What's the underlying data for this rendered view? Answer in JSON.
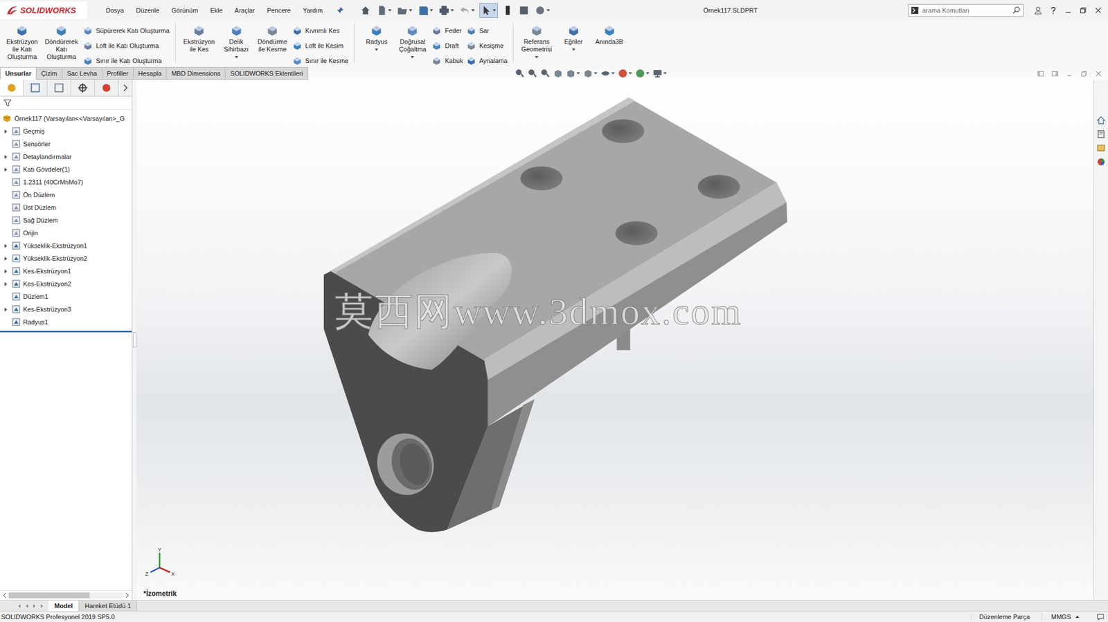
{
  "app": {
    "logo": "SOLIDWORKS",
    "title": "Örnek117.SLDPRT"
  },
  "menu": [
    "Dosya",
    "Düzenle",
    "Görünüm",
    "Ekle",
    "Araçlar",
    "Pencere",
    "Yardım"
  ],
  "search": {
    "placeholder": "arama Komutları"
  },
  "command_groups": [
    {
      "kind": "large",
      "lines": [
        "Ekstrüzyon",
        "ile Katı",
        "Oluşturma"
      ],
      "items": [],
      "dropdown": false,
      "divider_after": false
    },
    {
      "kind": "large",
      "lines": [
        "Döndürerek",
        "Katı",
        "Oluşturma"
      ],
      "items": [],
      "dropdown": false,
      "divider_after": false
    },
    {
      "kind": "stack",
      "lines": [],
      "items": [
        "Süpürerek Katı Oluşturma",
        "Loft ile Katı Oluşturma",
        "Sınır ile Katı Oluşturma"
      ],
      "dropdown": false,
      "divider_after": true
    },
    {
      "kind": "large",
      "lines": [
        "Ekstrüzyon",
        "ile Kes"
      ],
      "items": [],
      "dropdown": false,
      "divider_after": false
    },
    {
      "kind": "large",
      "lines": [
        "Delik",
        "Sihirbazı"
      ],
      "items": [],
      "dropdown": true,
      "divider_after": false
    },
    {
      "kind": "large",
      "lines": [
        "Döndürme",
        "ile Kesme"
      ],
      "items": [],
      "dropdown": false,
      "divider_after": false
    },
    {
      "kind": "stack",
      "lines": [],
      "items": [
        "Kıvrımlı Kes",
        "Loft ile Kesim",
        "Sınır ile Kesme"
      ],
      "dropdown": false,
      "divider_after": true
    },
    {
      "kind": "large",
      "lines": [
        "Radyus"
      ],
      "items": [],
      "dropdown": true,
      "divider_after": false
    },
    {
      "kind": "large",
      "lines": [
        "Doğrusal",
        "Çoğaltma"
      ],
      "items": [],
      "dropdown": true,
      "divider_after": false
    },
    {
      "kind": "stack",
      "lines": [],
      "items": [
        "Feder",
        "Draft",
        "Kabuk"
      ],
      "dropdown": false,
      "divider_after": false
    },
    {
      "kind": "stack",
      "lines": [],
      "items": [
        "Sar",
        "Kesişme",
        "Aynalama"
      ],
      "dropdown": false,
      "divider_after": true
    },
    {
      "kind": "large",
      "lines": [
        "Referans",
        "Geometrisi"
      ],
      "items": [],
      "dropdown": true,
      "divider_after": false
    },
    {
      "kind": "large",
      "lines": [
        "Eğriler"
      ],
      "items": [],
      "dropdown": true,
      "divider_after": false
    },
    {
      "kind": "large",
      "lines": [
        "Anında3B"
      ],
      "items": [],
      "dropdown": false,
      "divider_after": false
    }
  ],
  "tabs": [
    {
      "label": "Unsurlar",
      "selected": true
    },
    {
      "label": "Çizim",
      "selected": false
    },
    {
      "label": "Sac Levha",
      "selected": false
    },
    {
      "label": "Profiller",
      "selected": false
    },
    {
      "label": "Hesapla",
      "selected": false
    },
    {
      "label": "MBD Dimensions",
      "selected": false
    },
    {
      "label": "SOLIDWORKS Eklentileri",
      "selected": false
    }
  ],
  "panel_tabs": [
    {
      "selected": true
    },
    {
      "selected": false
    },
    {
      "selected": false
    },
    {
      "selected": false
    },
    {
      "selected": false
    }
  ],
  "tree": {
    "root": "Örnek117  (Varsayılan<<Varsayılan>_G",
    "items": [
      {
        "label": "Geçmiş",
        "expandable": true
      },
      {
        "label": "Sensörler",
        "expandable": false
      },
      {
        "label": "Detaylandırmalar",
        "expandable": true
      },
      {
        "label": "Katı Gövdeler(1)",
        "expandable": true
      },
      {
        "label": "1.2311 (40CrMnMo7)",
        "expandable": false
      },
      {
        "label": "Ön Düzlem",
        "expandable": false
      },
      {
        "label": "Üst Düzlem",
        "expandable": false
      },
      {
        "label": "Sağ Düzlem",
        "expandable": false
      },
      {
        "label": "Orijin",
        "expandable": false
      },
      {
        "label": "Yükseklik-Ekstrüzyon1",
        "expandable": true
      },
      {
        "label": "Yükseklik-Ekstrüzyon2",
        "expandable": true
      },
      {
        "label": "Kes-Ekstrüzyon1",
        "expandable": true
      },
      {
        "label": "Kes-Ekstrüzyon2",
        "expandable": true
      },
      {
        "label": "Düzlem1",
        "expandable": false
      },
      {
        "label": "Kes-Ekstrüzyon3",
        "expandable": true
      },
      {
        "label": "Radyus1",
        "expandable": false
      }
    ]
  },
  "viewport": {
    "view_label": "*İzometrik",
    "watermark": "莫西网www.3dmox.com",
    "triad": {
      "y": "Y",
      "x": "X",
      "z": "Z"
    }
  },
  "bottom_tabs": [
    {
      "label": "Model",
      "selected": true
    },
    {
      "label": "Hareket Etüdü 1",
      "selected": false
    }
  ],
  "status_bar": {
    "left": "SOLIDWORKS Profesyonel 2019 SP5.0",
    "mode": "Düzenleme Parça",
    "units": "MMGS"
  }
}
